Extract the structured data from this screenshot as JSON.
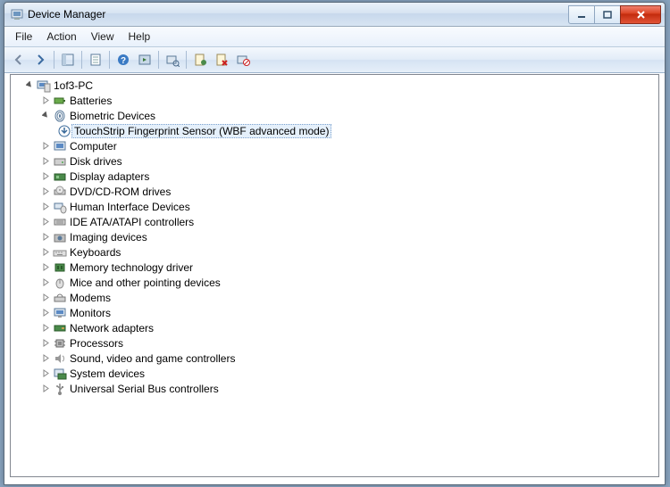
{
  "window": {
    "title": "Device Manager"
  },
  "menu": {
    "file": "File",
    "action": "Action",
    "view": "View",
    "help": "Help"
  },
  "tree": {
    "root": "1of3-PC",
    "batteries": "Batteries",
    "biometric": "Biometric Devices",
    "touchstrip": "TouchStrip Fingerprint Sensor (WBF advanced mode)",
    "computer": "Computer",
    "disk": "Disk drives",
    "display": "Display adapters",
    "dvd": "DVD/CD-ROM drives",
    "hid": "Human Interface Devices",
    "ide": "IDE ATA/ATAPI controllers",
    "imaging": "Imaging devices",
    "keyboards": "Keyboards",
    "memtech": "Memory technology driver",
    "mice": "Mice and other pointing devices",
    "modems": "Modems",
    "monitors": "Monitors",
    "network": "Network adapters",
    "processors": "Processors",
    "sound": "Sound, video and game controllers",
    "system": "System devices",
    "usb": "Universal Serial Bus controllers"
  }
}
